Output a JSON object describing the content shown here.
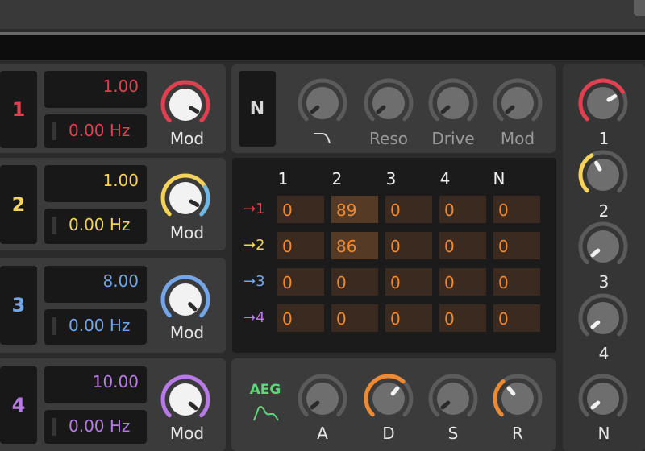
{
  "colors": {
    "osc1": "#e0404f",
    "osc2": "#f5d35a",
    "osc3": "#72a6e8",
    "osc4": "#b77ae6",
    "env": "#ef8a33",
    "aeg": "#5fd67a",
    "ring": "#5b5b5b"
  },
  "oscillators": [
    {
      "number": "1",
      "level": "1.00",
      "rate": "0.00 Hz",
      "knob_label": "Mod"
    },
    {
      "number": "2",
      "level": "1.00",
      "rate": "0.00 Hz",
      "knob_label": "Mod"
    },
    {
      "number": "3",
      "level": "8.00",
      "rate": "0.00 Hz",
      "knob_label": "Mod"
    },
    {
      "number": "4",
      "level": "10.00",
      "rate": "0.00 Hz",
      "knob_label": "Mod"
    }
  ],
  "noise": {
    "button_label": "N",
    "knobs": [
      {
        "label": "",
        "icon": "lowpass-filter-icon"
      },
      {
        "label": "Reso"
      },
      {
        "label": "Drive"
      },
      {
        "label": "Mod"
      }
    ]
  },
  "matrix": {
    "columns": [
      "1",
      "2",
      "3",
      "4",
      "N"
    ],
    "rows": [
      {
        "label": "→1",
        "values": [
          "0",
          "89",
          "0",
          "0",
          "0"
        ]
      },
      {
        "label": "→2",
        "values": [
          "0",
          "86",
          "0",
          "0",
          "0"
        ]
      },
      {
        "label": "→3",
        "values": [
          "0",
          "0",
          "0",
          "0",
          "0"
        ]
      },
      {
        "label": "→4",
        "values": [
          "0",
          "0",
          "0",
          "0",
          "0"
        ]
      }
    ]
  },
  "envelope": {
    "label": "AEG",
    "icon": "envelope-shape-icon",
    "knobs": [
      "A",
      "D",
      "S",
      "R"
    ]
  },
  "mixer": {
    "labels": [
      "1",
      "2",
      "3",
      "4",
      "N"
    ]
  }
}
